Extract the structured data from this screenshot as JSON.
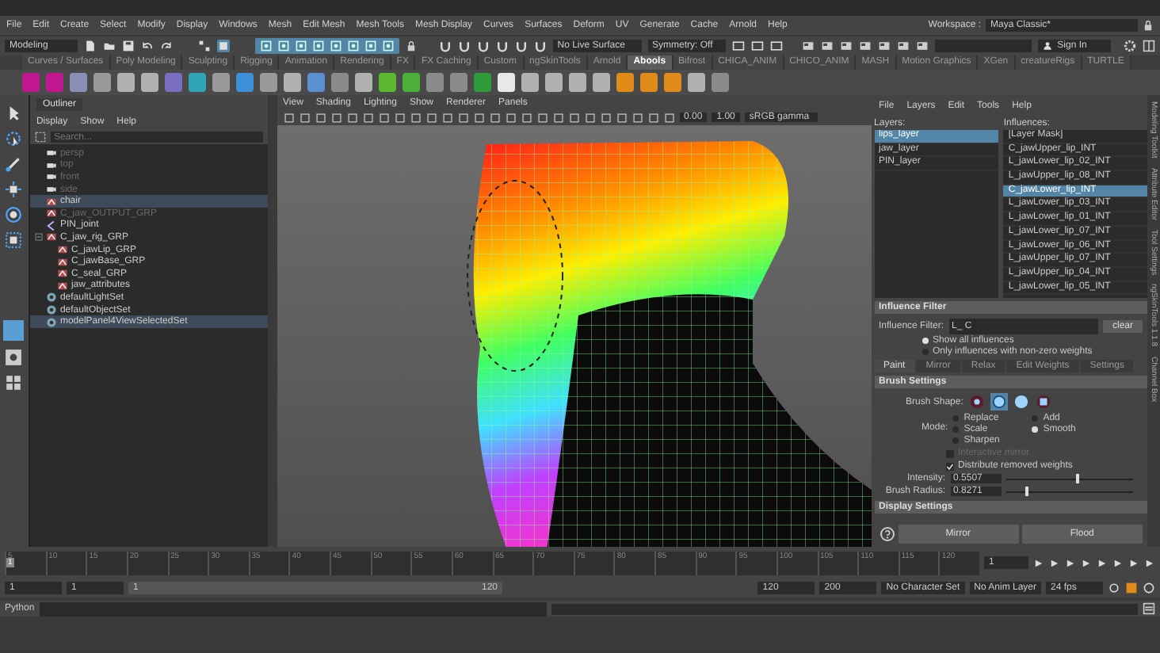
{
  "menu_bar": [
    "File",
    "Edit",
    "Create",
    "Select",
    "Modify",
    "Display",
    "Windows",
    "Mesh",
    "Edit Mesh",
    "Mesh Tools",
    "Mesh Display",
    "Curves",
    "Surfaces",
    "Deform",
    "UV",
    "Generate",
    "Cache",
    "Arnold",
    "Help"
  ],
  "workspace": {
    "label": "Workspace :",
    "value": "Maya Classic*"
  },
  "status_line": {
    "menu_set": "Modeling",
    "live_surface": "No Live Surface",
    "symmetry": "Symmetry: Off",
    "sign_in": "Sign In"
  },
  "shelf": {
    "tabs": [
      {
        "label": "Curves / Surfaces",
        "selected": false
      },
      {
        "label": "Poly Modeling",
        "selected": false
      },
      {
        "label": "Sculpting",
        "selected": false
      },
      {
        "label": "Rigging",
        "selected": false
      },
      {
        "label": "Animation",
        "selected": false
      },
      {
        "label": "Rendering",
        "selected": false
      },
      {
        "label": "FX",
        "selected": false
      },
      {
        "label": "FX Caching",
        "selected": false
      },
      {
        "label": "Custom",
        "selected": false
      },
      {
        "label": "ngSkinTools",
        "selected": false
      },
      {
        "label": "Arnold",
        "selected": false
      },
      {
        "label": "Abools",
        "selected": true
      },
      {
        "label": "Bifrost",
        "selected": false
      },
      {
        "label": "CHICA_ANIM",
        "selected": false
      },
      {
        "label": "CHICO_ANIM",
        "selected": false
      },
      {
        "label": "MASH",
        "selected": false
      },
      {
        "label": "Motion Graphics",
        "selected": false
      },
      {
        "label": "XGen",
        "selected": false
      },
      {
        "label": "creatureRigs",
        "selected": false
      },
      {
        "label": "TURTLE",
        "selected": false
      }
    ],
    "tools": [
      {
        "color": "#c2188f"
      },
      {
        "color": "#c2188f"
      },
      {
        "color": "#8a8fb8"
      },
      {
        "color": "#9a9a9a"
      },
      {
        "color": "#b0b0b0"
      },
      {
        "color": "#b0b0b0"
      },
      {
        "color": "#7a6fc0"
      },
      {
        "color": "#2fa3b8"
      },
      {
        "color": "#9a9a9a"
      },
      {
        "color": "#3d8fd8"
      },
      {
        "color": "#9a9a9a"
      },
      {
        "color": "#b0b0b0"
      },
      {
        "color": "#5a8fd0"
      },
      {
        "color": "#8a8a8a"
      },
      {
        "color": "#b0b0b0"
      },
      {
        "color": "#5cb82e"
      },
      {
        "color": "#4caf3a"
      },
      {
        "color": "#8a8a8a"
      },
      {
        "color": "#8a8a8a"
      },
      {
        "color": "#2e9a3a"
      },
      {
        "color": "#e8e8e8"
      },
      {
        "color": "#b0b0b0"
      },
      {
        "color": "#b0b0b0"
      },
      {
        "color": "#b0b0b0"
      },
      {
        "color": "#b0b0b0"
      },
      {
        "color": "#e08a1a"
      },
      {
        "color": "#e08a1a"
      },
      {
        "color": "#e08a1a"
      },
      {
        "color": "#b0b0b0"
      },
      {
        "color": "#8a8a8a"
      }
    ]
  },
  "outliner": {
    "title": "Outliner",
    "menu": [
      "Display",
      "Show",
      "Help"
    ],
    "search": {
      "placeholder": "Search..."
    },
    "items": [
      {
        "label": "persp",
        "kind": "camera",
        "hidden": true,
        "selected": false
      },
      {
        "label": "top",
        "kind": "camera",
        "hidden": true,
        "selected": false
      },
      {
        "label": "front",
        "kind": "camera",
        "hidden": true,
        "selected": false
      },
      {
        "label": "side",
        "kind": "camera",
        "hidden": true,
        "selected": false
      },
      {
        "label": "chair",
        "kind": "group",
        "hidden": false,
        "selected": true
      },
      {
        "label": "C_jaw_OUTPUT_GRP",
        "kind": "group",
        "hidden": true,
        "selected": false
      },
      {
        "label": "PIN_joint",
        "kind": "joint",
        "hidden": false,
        "selected": false
      },
      {
        "label": "C_jaw_rig_GRP",
        "kind": "group",
        "hidden": false,
        "selected": false,
        "children": [
          {
            "label": "C_jawLip_GRP",
            "kind": "group",
            "hidden": false,
            "selected": false
          },
          {
            "label": "C_jawBase_GRP",
            "kind": "group",
            "hidden": false,
            "selected": false
          },
          {
            "label": "C_seal_GRP",
            "kind": "group",
            "hidden": false,
            "selected": false
          },
          {
            "label": "jaw_attributes",
            "kind": "group",
            "hidden": false,
            "selected": false
          }
        ]
      },
      {
        "label": "defaultLightSet",
        "kind": "set",
        "hidden": false,
        "selected": false
      },
      {
        "label": "defaultObjectSet",
        "kind": "set",
        "hidden": false,
        "selected": false
      },
      {
        "label": "modelPanel4ViewSelectedSet",
        "kind": "set",
        "hidden": false,
        "selected": true
      }
    ]
  },
  "viewport": {
    "menu": [
      "View",
      "Shading",
      "Lighting",
      "Show",
      "Renderer",
      "Panels"
    ],
    "exposure": "0.00",
    "gamma": "1.00",
    "color_space": "sRGB gamma"
  },
  "skin_tools": {
    "menu": [
      "File",
      "Layers",
      "Edit",
      "Tools",
      "Help"
    ],
    "layers_label": "Layers:",
    "influences_label": "Influences:",
    "layers": [
      {
        "label": "lips_layer",
        "selected": true
      },
      {
        "label": "jaw_layer",
        "selected": false
      },
      {
        "label": "PIN_layer",
        "selected": false
      }
    ],
    "influences": [
      {
        "label": "[Layer Mask]",
        "selected": false
      },
      {
        "label": "C_jawUpper_lip_INT",
        "selected": false
      },
      {
        "label": "L_jawLower_lip_02_INT",
        "selected": false
      },
      {
        "label": "L_jawUpper_lip_08_INT",
        "selected": false
      },
      {
        "label": "C_jawLower_lip_INT",
        "selected": true
      },
      {
        "label": "L_jawLower_lip_03_INT",
        "selected": false
      },
      {
        "label": "L_jawLower_lip_01_INT",
        "selected": false
      },
      {
        "label": "L_jawLower_lip_07_INT",
        "selected": false
      },
      {
        "label": "L_jawLower_lip_06_INT",
        "selected": false
      },
      {
        "label": "L_jawUpper_lip_07_INT",
        "selected": false
      },
      {
        "label": "L_jawUpper_lip_04_INT",
        "selected": false
      },
      {
        "label": "L_jawLower_lip_05_INT",
        "selected": false
      }
    ],
    "filter_section": "Influence Filter",
    "filter_label": "Influence Filter:",
    "filter_value": "L_ C",
    "clear": "clear",
    "filter_options": [
      {
        "label": "Show all influences",
        "selected": true
      },
      {
        "label": "Only influences with non-zero weights",
        "selected": false
      }
    ],
    "tabs": [
      {
        "label": "Paint",
        "selected": true
      },
      {
        "label": "Mirror",
        "selected": false
      },
      {
        "label": "Relax",
        "selected": false
      },
      {
        "label": "Edit Weights",
        "selected": false
      },
      {
        "label": "Settings",
        "selected": false
      }
    ],
    "brush_section": "Brush Settings",
    "brush_shape_label": "Brush Shape:",
    "brush_shapes": [
      {
        "kind": "dot",
        "selected": false
      },
      {
        "kind": "ring",
        "selected": true
      },
      {
        "kind": "disc",
        "selected": false
      },
      {
        "kind": "square",
        "selected": false
      }
    ],
    "mode_label": "Mode:",
    "modes": [
      {
        "label": "Replace",
        "selected": false
      },
      {
        "label": "Add",
        "selected": false
      },
      {
        "label": "Scale",
        "selected": false
      },
      {
        "label": "Smooth",
        "selected": true
      },
      {
        "label": "Sharpen",
        "selected": false
      }
    ],
    "options": [
      {
        "label": "Interactive mirror",
        "checked": false,
        "disabled": true
      },
      {
        "label": "Distribute removed weights",
        "checked": true,
        "disabled": false
      }
    ],
    "sliders": [
      {
        "label": "Intensity:",
        "value": "0.5507",
        "level": 0.55
      },
      {
        "label": "Brush Radius:",
        "value": "0.8271",
        "level": 0.16
      }
    ],
    "display_section": "Display Settings",
    "buttons": [
      "Mirror",
      "Flood"
    ]
  },
  "side_tabs": [
    "Modeling Toolkit",
    "Attribute Editor",
    "Tool Settings",
    "ngSkinTools 1.1.8",
    "Channel Box"
  ],
  "timeline": {
    "ticks": [
      "5",
      "10",
      "15",
      "20",
      "25",
      "30",
      "35",
      "40",
      "45",
      "50",
      "55",
      "60",
      "65",
      "70",
      "75",
      "80",
      "85",
      "90",
      "95",
      "100",
      "105",
      "110",
      "115",
      "120"
    ],
    "current_frame": "1",
    "current_time": "1"
  },
  "range": {
    "start": "1",
    "playback_start": "1",
    "slider_start": "1",
    "slider_end": "120",
    "playback_end": "120",
    "end": "200",
    "character_set": "No Character Set",
    "anim_layer": "No Anim Layer",
    "fps": "24 fps"
  },
  "command_line": {
    "language": "Python"
  }
}
